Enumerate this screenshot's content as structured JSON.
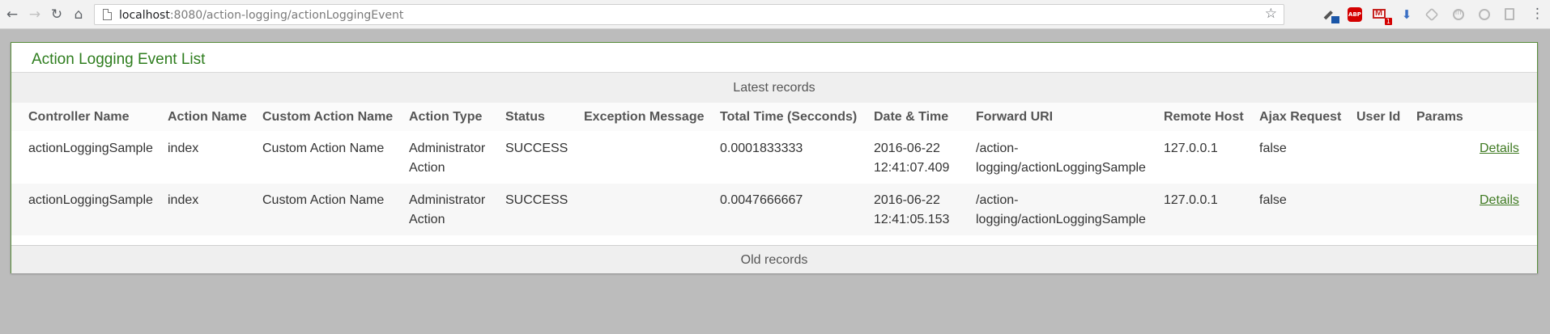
{
  "browser": {
    "url_host": "localhost",
    "url_rest": ":8080/action-logging/actionLoggingEvent",
    "abp_label": "ABP",
    "gmail_count": "1"
  },
  "panel": {
    "title": "Action Logging Event List",
    "latest_label": "Latest records",
    "old_label": "Old records"
  },
  "table": {
    "columns": [
      "Controller Name",
      "Action Name",
      "Custom Action Name",
      "Action Type",
      "Status",
      "Exception Message",
      "Total Time (Secconds)",
      "Date & Time",
      "Forward URI",
      "Remote Host",
      "Ajax Request",
      "User Id",
      "Params"
    ],
    "rows": [
      {
        "controller": "actionLoggingSample",
        "action": "index",
        "custom_action": "Custom Action Name",
        "action_type_1": "Administrator",
        "action_type_2": "Action",
        "status": "SUCCESS",
        "exception": "",
        "total_time": "0.0001833333",
        "date": "2016-06-22",
        "time": "12:41:07.409",
        "forward_uri_1": "/action-",
        "forward_uri_2": "logging/actionLoggingSample",
        "remote_host": "127.0.0.1",
        "ajax": "false",
        "user_id": "",
        "params": "",
        "details": "Details"
      },
      {
        "controller": "actionLoggingSample",
        "action": "index",
        "custom_action": "Custom Action Name",
        "action_type_1": "Administrator",
        "action_type_2": "Action",
        "status": "SUCCESS",
        "exception": "",
        "total_time": "0.0047666667",
        "date": "2016-06-22",
        "time": "12:41:05.153",
        "forward_uri_1": "/action-",
        "forward_uri_2": "logging/actionLoggingSample",
        "remote_host": "127.0.0.1",
        "ajax": "false",
        "user_id": "",
        "params": "",
        "details": "Details"
      }
    ]
  }
}
